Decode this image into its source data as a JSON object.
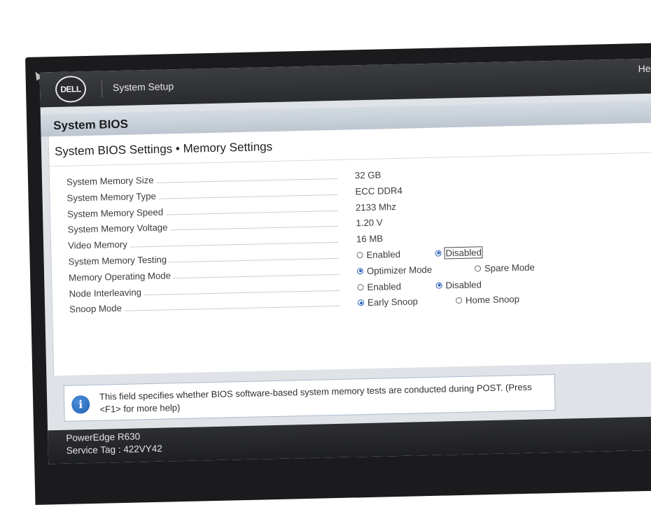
{
  "header": {
    "logo": "DELL",
    "app_title": "System Setup",
    "help_link": "He"
  },
  "panel": {
    "title": "System BIOS"
  },
  "page": {
    "title": "System BIOS Settings • Memory Settings"
  },
  "settings": [
    {
      "label": "System Memory Size",
      "value": "32 GB"
    },
    {
      "label": "System Memory Type",
      "value": "ECC DDR4"
    },
    {
      "label": "System Memory Speed",
      "value": "2133 Mhz"
    },
    {
      "label": "System Memory Voltage",
      "value": "1.20 V"
    },
    {
      "label": "Video Memory",
      "value": "16 MB"
    },
    {
      "label": "System Memory Testing",
      "options": [
        "Enabled",
        "Disabled"
      ],
      "selected": "Disabled"
    },
    {
      "label": "Memory Operating Mode",
      "options": [
        "Optimizer Mode",
        "Spare Mode"
      ],
      "selected": "Optimizer Mode"
    },
    {
      "label": "Node Interleaving",
      "options": [
        "Enabled",
        "Disabled"
      ],
      "selected": "Disabled"
    },
    {
      "label": "Snoop Mode",
      "options": [
        "Early Snoop",
        "Home Snoop"
      ],
      "selected": "Early Snoop"
    }
  ],
  "help": {
    "icon": "info-icon",
    "text": "This field specifies whether BIOS software-based system memory tests are conducted during POST. (Press <F1> for more help)"
  },
  "footer": {
    "model": "PowerEdge R630",
    "service_tag": "Service Tag : 422VY42"
  },
  "colors": {
    "accent": "#2b63b8",
    "topbar": "#2a2b2e",
    "panel_header": "#c8d0d8"
  }
}
